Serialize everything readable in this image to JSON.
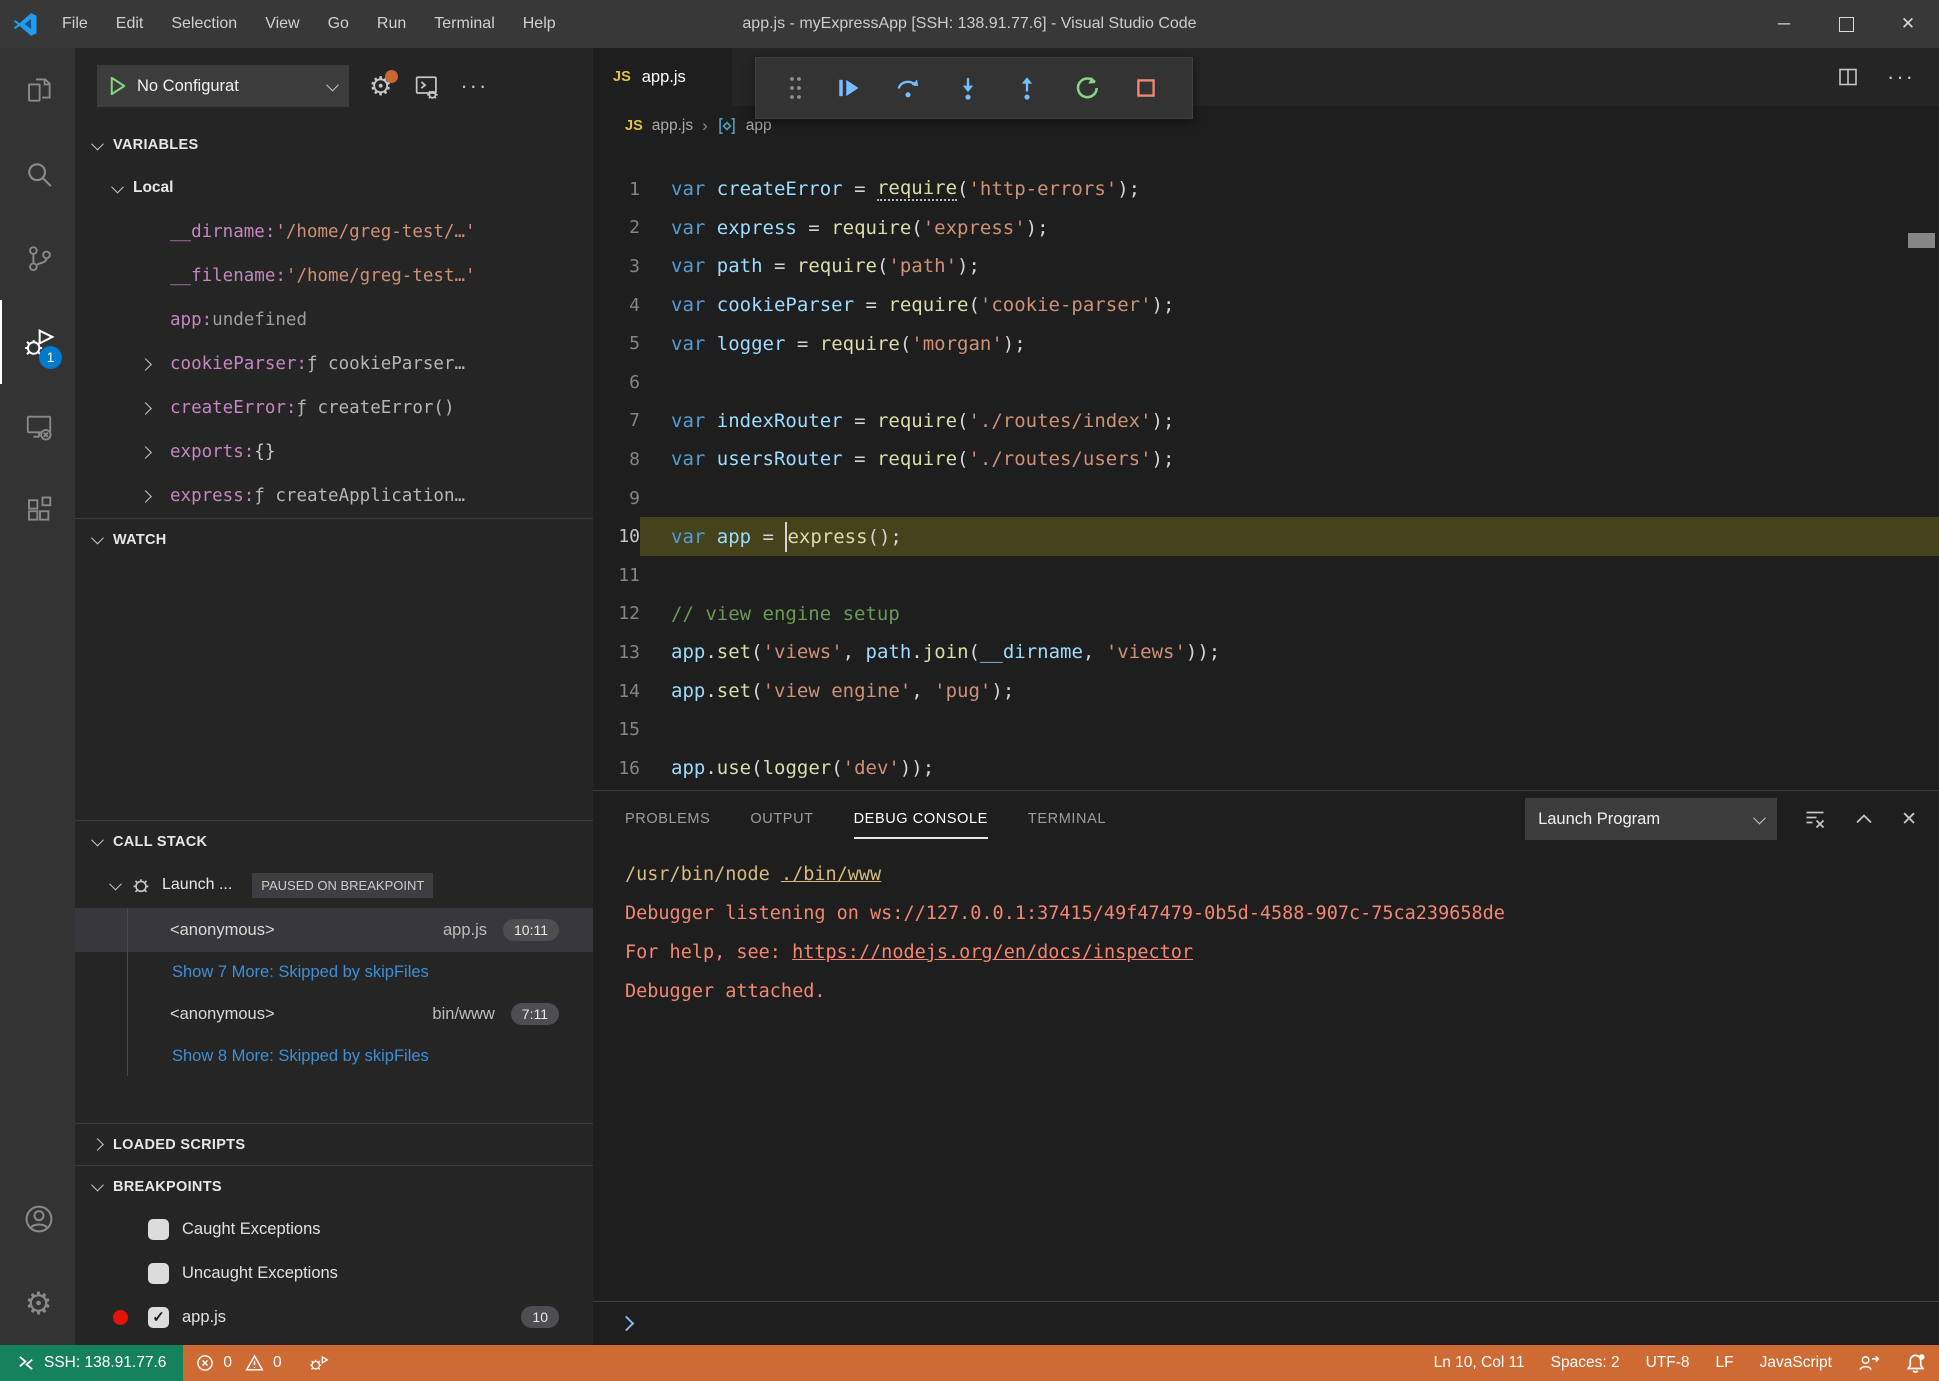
{
  "colors": {
    "remote_green": "#16825d",
    "debug_orange": "#ce6a34",
    "badge_blue": "#007acc",
    "breakpoint_red": "#e51400",
    "current_line": "#45431b"
  },
  "titlebar": {
    "title": "app.js - myExpressApp [SSH: 138.91.77.6] - Visual Studio Code",
    "menus": [
      "File",
      "Edit",
      "Selection",
      "View",
      "Go",
      "Run",
      "Terminal",
      "Help"
    ]
  },
  "activity_bar": {
    "items": [
      {
        "name": "explorer",
        "active": false
      },
      {
        "name": "search",
        "active": false
      },
      {
        "name": "source-control",
        "active": false
      },
      {
        "name": "run-and-debug",
        "active": true,
        "badge": "1"
      },
      {
        "name": "remote-explorer",
        "active": false
      },
      {
        "name": "extensions",
        "active": false
      }
    ],
    "bottom": [
      {
        "name": "account"
      },
      {
        "name": "settings"
      }
    ]
  },
  "sidebar": {
    "toolbar": {
      "config_label": "No Configurat"
    },
    "variables": {
      "header": "VARIABLES",
      "scope": "Local",
      "items": [
        {
          "name": "__dirname",
          "value": "'/home/greg-test/…'",
          "vtype": "str",
          "expandable": false
        },
        {
          "name": "__filename",
          "value": "'/home/greg-test…'",
          "vtype": "str",
          "expandable": false
        },
        {
          "name": "app",
          "value": "undefined",
          "vtype": "undef",
          "expandable": false
        },
        {
          "name": "cookieParser",
          "value": "ƒ cookieParser…",
          "vtype": "fn",
          "expandable": true
        },
        {
          "name": "createError",
          "value": "ƒ createError()",
          "vtype": "fn",
          "expandable": true
        },
        {
          "name": "exports",
          "value": "{}",
          "vtype": "obj",
          "expandable": true
        },
        {
          "name": "express",
          "value": "ƒ createApplication…",
          "vtype": "fn",
          "expandable": true
        }
      ]
    },
    "watch": {
      "header": "WATCH"
    },
    "call_stack": {
      "header": "CALL STACK",
      "session": {
        "label": "Launch ...",
        "status": "PAUSED ON BREAKPOINT"
      },
      "rows": [
        {
          "type": "frame",
          "name": "<anonymous>",
          "file": "app.js",
          "pos": "10:11",
          "selected": true
        },
        {
          "type": "link",
          "label": "Show 7 More: Skipped by skipFiles"
        },
        {
          "type": "frame",
          "name": "<anonymous>",
          "file": "bin/www",
          "pos": "7:11",
          "selected": false
        },
        {
          "type": "link",
          "label": "Show 8 More: Skipped by skipFiles"
        }
      ]
    },
    "loaded_scripts": {
      "header": "LOADED SCRIPTS"
    },
    "breakpoints": {
      "header": "BREAKPOINTS",
      "items": [
        {
          "label": "Caught Exceptions",
          "checked": false,
          "dot": false,
          "badge": ""
        },
        {
          "label": "Uncaught Exceptions",
          "checked": false,
          "dot": false,
          "badge": ""
        },
        {
          "label": "app.js",
          "checked": true,
          "dot": true,
          "badge": "10"
        }
      ]
    }
  },
  "editor": {
    "tab": {
      "label": "app.js"
    },
    "breadcrumbs": {
      "file": "app.js",
      "symbol": "app"
    },
    "debug_toolbar": [
      "drag-grip",
      "continue",
      "step-over",
      "step-into",
      "step-out",
      "restart",
      "stop"
    ],
    "code": {
      "current_line": 10,
      "lines": [
        {
          "n": 1,
          "t": [
            [
              "kw",
              "var"
            ],
            [
              "pl",
              " "
            ],
            [
              "id",
              "createError"
            ],
            [
              "pl",
              " = "
            ],
            [
              "fnh",
              "require"
            ],
            [
              "pl",
              "("
            ],
            [
              "str",
              "'http-errors'"
            ],
            [
              "pl",
              ");"
            ]
          ]
        },
        {
          "n": 2,
          "t": [
            [
              "kw",
              "var"
            ],
            [
              "pl",
              " "
            ],
            [
              "id",
              "express"
            ],
            [
              "pl",
              " = "
            ],
            [
              "fn",
              "require"
            ],
            [
              "pl",
              "("
            ],
            [
              "str",
              "'express'"
            ],
            [
              "pl",
              ");"
            ]
          ]
        },
        {
          "n": 3,
          "t": [
            [
              "kw",
              "var"
            ],
            [
              "pl",
              " "
            ],
            [
              "id",
              "path"
            ],
            [
              "pl",
              " = "
            ],
            [
              "fn",
              "require"
            ],
            [
              "pl",
              "("
            ],
            [
              "str",
              "'path'"
            ],
            [
              "pl",
              ");"
            ]
          ]
        },
        {
          "n": 4,
          "t": [
            [
              "kw",
              "var"
            ],
            [
              "pl",
              " "
            ],
            [
              "id",
              "cookieParser"
            ],
            [
              "pl",
              " = "
            ],
            [
              "fn",
              "require"
            ],
            [
              "pl",
              "("
            ],
            [
              "str",
              "'cookie-parser'"
            ],
            [
              "pl",
              ");"
            ]
          ]
        },
        {
          "n": 5,
          "t": [
            [
              "kw",
              "var"
            ],
            [
              "pl",
              " "
            ],
            [
              "id",
              "logger"
            ],
            [
              "pl",
              " = "
            ],
            [
              "fn",
              "require"
            ],
            [
              "pl",
              "("
            ],
            [
              "str",
              "'morgan'"
            ],
            [
              "pl",
              ");"
            ]
          ]
        },
        {
          "n": 6,
          "t": []
        },
        {
          "n": 7,
          "t": [
            [
              "kw",
              "var"
            ],
            [
              "pl",
              " "
            ],
            [
              "id",
              "indexRouter"
            ],
            [
              "pl",
              " = "
            ],
            [
              "fn",
              "require"
            ],
            [
              "pl",
              "("
            ],
            [
              "str",
              "'./routes/index'"
            ],
            [
              "pl",
              ");"
            ]
          ]
        },
        {
          "n": 8,
          "t": [
            [
              "kw",
              "var"
            ],
            [
              "pl",
              " "
            ],
            [
              "id",
              "usersRouter"
            ],
            [
              "pl",
              " = "
            ],
            [
              "fn",
              "require"
            ],
            [
              "pl",
              "("
            ],
            [
              "str",
              "'./routes/users'"
            ],
            [
              "pl",
              ");"
            ]
          ]
        },
        {
          "n": 9,
          "t": []
        },
        {
          "n": 10,
          "t": [
            [
              "kw",
              "var"
            ],
            [
              "pl",
              " "
            ],
            [
              "id",
              "app"
            ],
            [
              "pl",
              " = "
            ],
            [
              "cur",
              ""
            ],
            [
              "fn",
              "express"
            ],
            [
              "pl",
              "();"
            ]
          ]
        },
        {
          "n": 11,
          "t": []
        },
        {
          "n": 12,
          "t": [
            [
              "cmt",
              "// view engine setup"
            ]
          ]
        },
        {
          "n": 13,
          "t": [
            [
              "id",
              "app"
            ],
            [
              "pl",
              "."
            ],
            [
              "fn",
              "set"
            ],
            [
              "pl",
              "("
            ],
            [
              "str",
              "'views'"
            ],
            [
              "pl",
              ", "
            ],
            [
              "id",
              "path"
            ],
            [
              "pl",
              "."
            ],
            [
              "fn",
              "join"
            ],
            [
              "pl",
              "("
            ],
            [
              "id",
              "__dirname"
            ],
            [
              "pl",
              ", "
            ],
            [
              "str",
              "'views'"
            ],
            [
              "pl",
              "));"
            ]
          ]
        },
        {
          "n": 14,
          "t": [
            [
              "id",
              "app"
            ],
            [
              "pl",
              "."
            ],
            [
              "fn",
              "set"
            ],
            [
              "pl",
              "("
            ],
            [
              "str",
              "'view engine'"
            ],
            [
              "pl",
              ", "
            ],
            [
              "str",
              "'pug'"
            ],
            [
              "pl",
              ");"
            ]
          ]
        },
        {
          "n": 15,
          "t": []
        },
        {
          "n": 16,
          "t": [
            [
              "id",
              "app"
            ],
            [
              "pl",
              "."
            ],
            [
              "fn",
              "use"
            ],
            [
              "pl",
              "("
            ],
            [
              "fn",
              "logger"
            ],
            [
              "pl",
              "("
            ],
            [
              "str",
              "'dev'"
            ],
            [
              "pl",
              "));"
            ]
          ]
        }
      ]
    }
  },
  "panel": {
    "tabs": [
      "PROBLEMS",
      "OUTPUT",
      "DEBUG CONSOLE",
      "TERMINAL"
    ],
    "active_tab": "DEBUG CONSOLE",
    "dropdown": "Launch Program",
    "console": [
      {
        "parts": [
          {
            "t": "/usr/bin/node ",
            "c": "cmd",
            "u": false
          },
          {
            "t": "./bin/www",
            "c": "cmd",
            "u": true
          }
        ]
      },
      {
        "parts": [
          {
            "t": "Debugger listening on ws://127.0.0.1:37415/49f47479-0b5d-4588-907c-75ca239658de",
            "c": "out",
            "u": false
          }
        ]
      },
      {
        "parts": [
          {
            "t": "For help, see: ",
            "c": "out",
            "u": false
          },
          {
            "t": "https://nodejs.org/en/docs/inspector",
            "c": "out",
            "u": true
          }
        ]
      },
      {
        "parts": [
          {
            "t": "Debugger attached.",
            "c": "out",
            "u": false
          }
        ]
      }
    ]
  },
  "status_bar": {
    "remote": "SSH: 138.91.77.6",
    "errors": "0",
    "warnings": "0",
    "right_items": [
      "Ln 10, Col 11",
      "Spaces: 2",
      "UTF-8",
      "LF",
      "JavaScript"
    ]
  }
}
